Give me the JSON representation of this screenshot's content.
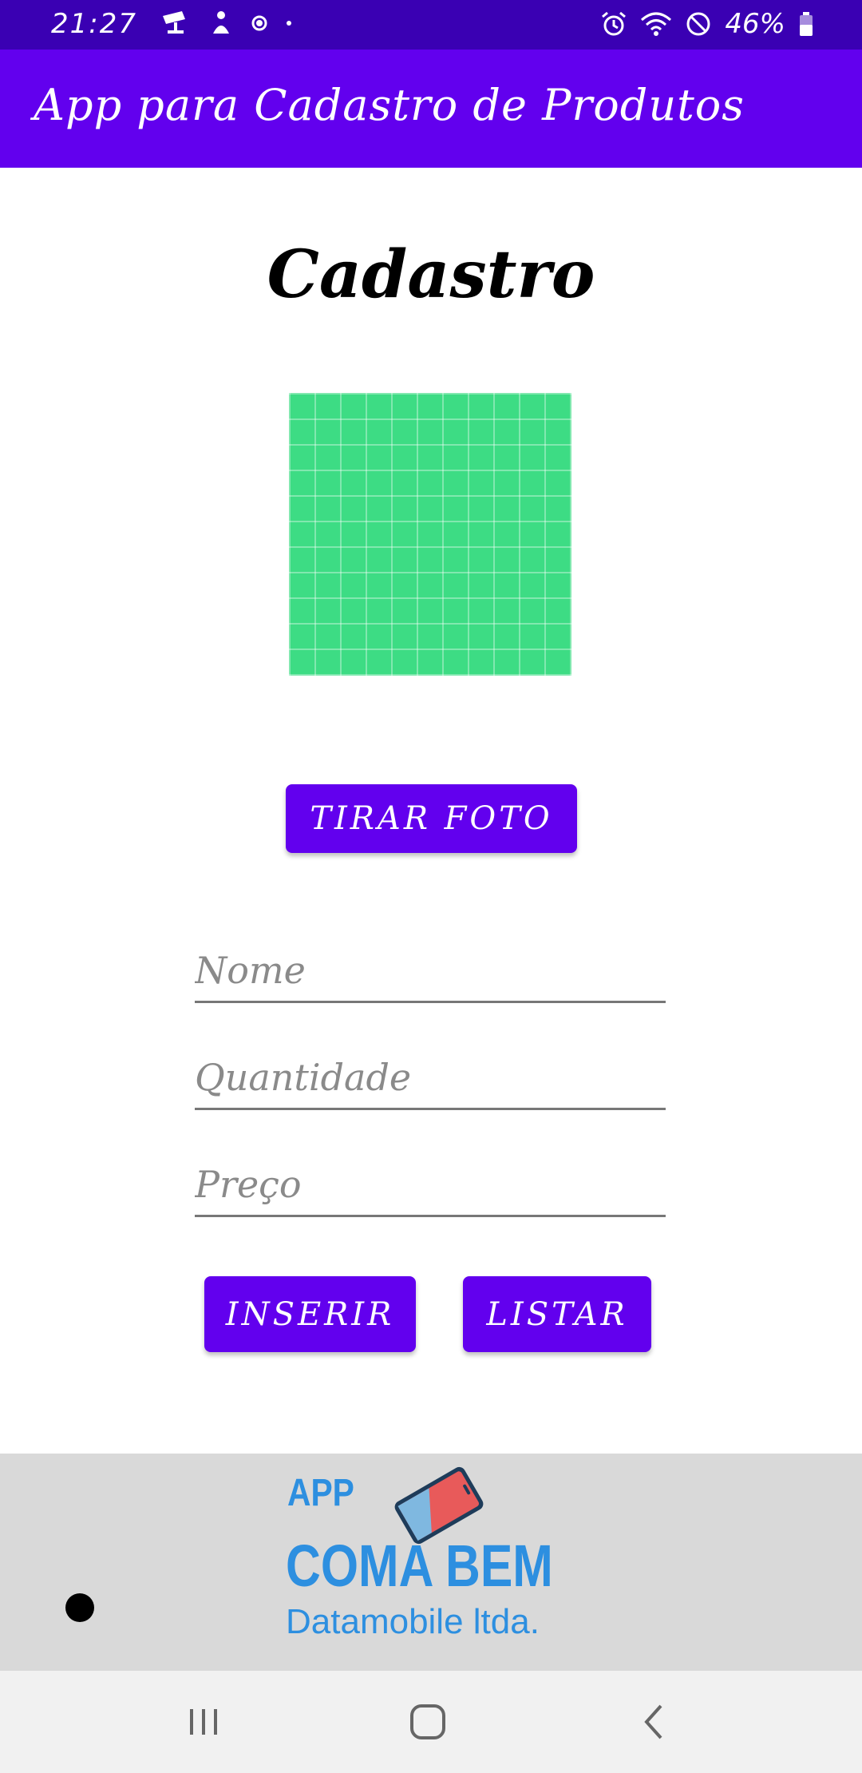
{
  "status_bar": {
    "time": "21:27",
    "battery": "46%",
    "icons": [
      "cctv-icon",
      "person-icon",
      "circle-dot-icon",
      "small-dot-icon",
      "alarm-icon",
      "wifi-icon",
      "do-not-disturb-icon",
      "battery-icon"
    ]
  },
  "app_bar": {
    "title": "App para Cadastro de Produtos"
  },
  "main": {
    "title": "Cadastro",
    "photo_button_label": "TIRAR FOTO",
    "fields": {
      "name_placeholder": "Nome",
      "quantity_placeholder": "Quantidade",
      "price_placeholder": "Preço"
    },
    "insert_button_label": "INSERIR",
    "list_button_label": "LISTAR"
  },
  "banner": {
    "app_text": "APP",
    "brand_text": "COMA BEM",
    "company_text": "Datamobile ltda."
  },
  "colors": {
    "primary": "#6200ee",
    "status_bar": "#3a00b3",
    "photo": "#3ddc84",
    "banner_text": "#2d8fe0"
  }
}
